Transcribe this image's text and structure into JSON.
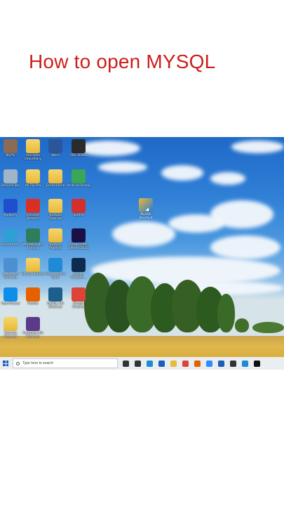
{
  "video_title": "How to open MYSQL",
  "desktop": {
    "icons": [
      {
        "label": "MyPic",
        "icon": "photo-icon",
        "color": "#8b6b54"
      },
      {
        "label": "muradali chaudhary",
        "icon": "folder-icon",
        "color": "#e8b93a"
      },
      {
        "label": "Word",
        "icon": "word-icon",
        "color": "#2b579a"
      },
      {
        "label": "OBS Studio",
        "icon": "obs-icon",
        "color": "#2b2b2b"
      },
      {
        "label": "Recycle Bin",
        "icon": "recycle-bin-icon",
        "color": "#9fb6c9"
      },
      {
        "label": "All Zip Pro",
        "icon": "folder-icon",
        "color": "#e8b93a"
      },
      {
        "label": "Ecommerce",
        "icon": "folder-icon",
        "color": "#e8b93a"
      },
      {
        "label": "Android Studio",
        "icon": "android-studio-icon",
        "color": "#3aa757"
      },
      {
        "label": "Audacity",
        "icon": "audacity-icon",
        "color": "#1f4fcf"
      },
      {
        "label": "Chrome Remote",
        "icon": "chrome-remote-icon",
        "color": "#d93025"
      },
      {
        "label": "Youtube Tutorials",
        "icon": "folder-icon",
        "color": "#e8b93a"
      },
      {
        "label": "outline",
        "icon": "pdf-icon",
        "color": "#d32f2f"
      },
      {
        "label": "Kinemaster",
        "icon": "kinemaster-icon",
        "color": "#2f9fd6"
      },
      {
        "label": "Wondershare Filmora",
        "icon": "filmora-icon",
        "color": "#2e7d5b"
      },
      {
        "label": "Youtube Projects",
        "icon": "folder-icon",
        "color": "#e8b93a"
      },
      {
        "label": "Adobe After Effects 2020",
        "icon": "after-effects-icon",
        "color": "#1a1045"
      },
      {
        "label": "netbeans/ Shortcut",
        "icon": "netbeans-icon",
        "color": "#4c8fd3"
      },
      {
        "label": "Shafiq Mobiles",
        "icon": "folder-icon",
        "color": "#e8b93a"
      },
      {
        "label": "Visual Studio Code",
        "icon": "vscode-icon",
        "color": "#1f8ad6"
      },
      {
        "label": "Adobe Photosh...",
        "icon": "photoshop-icon",
        "color": "#0d2b4e"
      },
      {
        "label": "TeamViewer",
        "icon": "teamviewer-icon",
        "color": "#0e8ee9"
      },
      {
        "label": "Firefox",
        "icon": "firefox-icon",
        "color": "#e66000"
      },
      {
        "label": "MySQL 8.0 Shortcut",
        "icon": "mysql-icon",
        "color": "#1d5f8c"
      },
      {
        "label": "Google Chrome",
        "icon": "chrome-icon",
        "color": "#db4437"
      },
      {
        "label": "Youtube Material",
        "icon": "folder-icon",
        "color": "#e8b93a"
      },
      {
        "label": "Complete Kit Shortcut",
        "icon": "winrar-icon",
        "color": "#5b3a8a"
      }
    ],
    "floating_icon": {
      "label": "MySQL Shortcut",
      "icon": "mysql-shortcut-icon"
    }
  },
  "taskbar": {
    "search_placeholder": "Type here to search",
    "pinned": [
      {
        "name": "cortana-icon",
        "color": "#333333"
      },
      {
        "name": "task-view-icon",
        "color": "#333333"
      },
      {
        "name": "edge-icon",
        "color": "#1f8ad6"
      },
      {
        "name": "mail-icon",
        "color": "#1d5fb8"
      },
      {
        "name": "file-explorer-icon",
        "color": "#e8b93a"
      },
      {
        "name": "chrome-icon",
        "color": "#db4437"
      },
      {
        "name": "firefox-icon",
        "color": "#e66000"
      },
      {
        "name": "zoom-icon",
        "color": "#2d8cff"
      },
      {
        "name": "calendar-icon",
        "color": "#1d5fb8"
      },
      {
        "name": "store-icon",
        "color": "#333333"
      },
      {
        "name": "photos-icon",
        "color": "#1f8ad6"
      },
      {
        "name": "terminal-icon",
        "color": "#111111"
      }
    ]
  }
}
